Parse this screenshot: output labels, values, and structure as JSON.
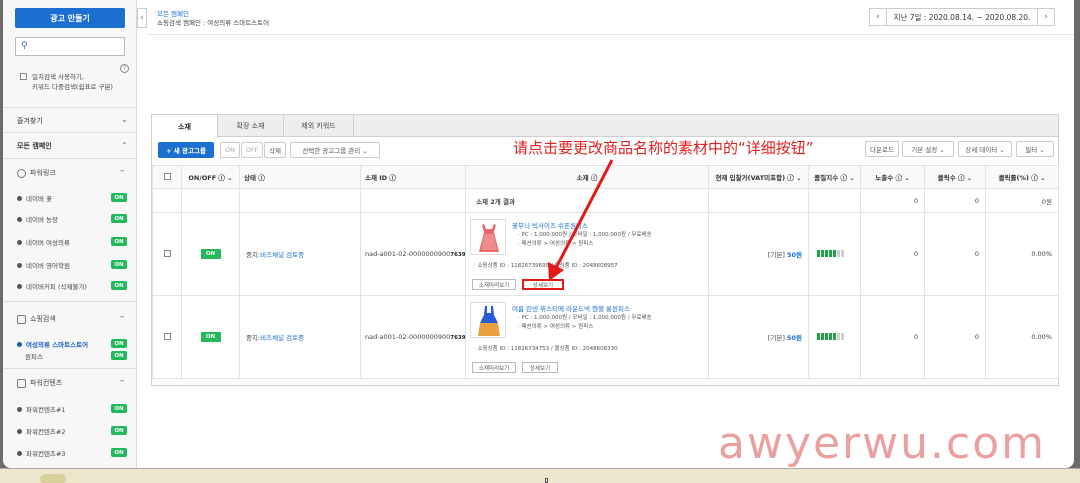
{
  "sidebar": {
    "create_button": "광고 만들기",
    "search_placeholder": "",
    "bulk_search_line1": "일치검색 사용하기,",
    "bulk_search_line2": "키워드 다중검색(쉼표로 구분)",
    "favorites": "즐겨찾기",
    "all_campaigns": "모든 캠페인",
    "groups": [
      {
        "label": "파워링크",
        "items": [
          "네이버 꽃",
          "네이버 농장",
          "네이버 여성의류",
          "네이버 영어학원",
          "네이버커피 (삭제불가)"
        ]
      },
      {
        "label": "쇼핑검색",
        "active_item": "여성의류 스마트스토어",
        "sub_item": "원피스"
      },
      {
        "label": "파워컨텐츠",
        "items": [
          "파워컨텐츠#1",
          "파워컨텐츠#2",
          "파워컨텐츠#3"
        ]
      }
    ],
    "on_label": "ON"
  },
  "header": {
    "crumb_top": "모든 캠페인",
    "crumb_current": "쇼핑검색 캠페인 : 여성의류 스마트스토어",
    "date_range": "지난 7일 : 2020.08.14. ~ 2020.08.20."
  },
  "tabs": [
    "소재",
    "확장 소재",
    "제외 키워드"
  ],
  "toolbar": {
    "new_group": "+ 새 광고그룹",
    "on": "ON",
    "off": "OFF",
    "delete": "삭제",
    "manage": "선택한 광고그룹 관리 ⌄",
    "download": "다운로드",
    "basic_setting": "기본 설정 ⌄",
    "detail_data": "상세 데이터 ⌄",
    "filter": "필터 ⌄"
  },
  "annotation": "请点击要更改商品名称的素材中的“详细按钮”",
  "table": {
    "headers": [
      "ON/OFF ⓘ ⌄",
      "상태 ⓘ",
      "소재 ID ⓘ",
      "소재 ⓘ",
      "현재 입찰가(VAT미포함) ⓘ ⌄",
      "품질지수 ⓘ ⌄",
      "노출수 ⓘ ⌄",
      "클릭수 ⓘ ⌄",
      "클릭률(%) ⓘ ⌄"
    ],
    "total": {
      "label": "소재 2개 결과",
      "impressions": "0",
      "clicks": "0",
      "ctr": "0원"
    },
    "rows": [
      {
        "toggle": "ON",
        "status_prefix": "중지:",
        "status_link": "비즈채널 검토중",
        "id_prefix": "nad-a001-02-0000000900",
        "id_suffix": "763954",
        "title": "꽃무늬 빅사이즈 쉬폰원피스",
        "line1": "· PC : 1,000,000원 / 모바일 : 1,000,000원 / 무료배송",
        "line2": "· 패션의류 > 여성의류 > 원피스",
        "ids": "· 쇼핑상품 ID : 11826739695 / 몰상품 ID : 2048608957",
        "preview_btn": "소재미리보기",
        "detail_btn": "상세보기",
        "bid_prefix": "[기본]",
        "bid": "50원",
        "quality": 5,
        "impressions": "0",
        "clicks": "0",
        "ctr": "0.00%"
      },
      {
        "toggle": "ON",
        "status_prefix": "중지:",
        "status_link": "비즈채널 검토중",
        "id_prefix": "nad-a001-02-0000000900",
        "id_suffix": "763955",
        "title": "여름 린넨 뷔스티에 라운드넥 헨젤 롱원피스",
        "line1": "· PC : 1,000,000원 / 모바일 : 1,000,000원 / 무료배송",
        "line2": "· 패션의류 > 여성의류 > 원피스",
        "ids": "· 쇼핑상품 ID : 11826734753 / 몰상품 ID : 2048608330",
        "preview_btn": "소재미리보기",
        "detail_btn": "상세보기",
        "bid_prefix": "[기본]",
        "bid": "50원",
        "quality": 5,
        "impressions": "0",
        "clicks": "0",
        "ctr": "0.00%"
      }
    ]
  },
  "watermark": "awyerwu.com",
  "colors": {
    "accent": "#1a6fd0",
    "on_green": "#23b85a",
    "annotation_red": "#e02020"
  }
}
